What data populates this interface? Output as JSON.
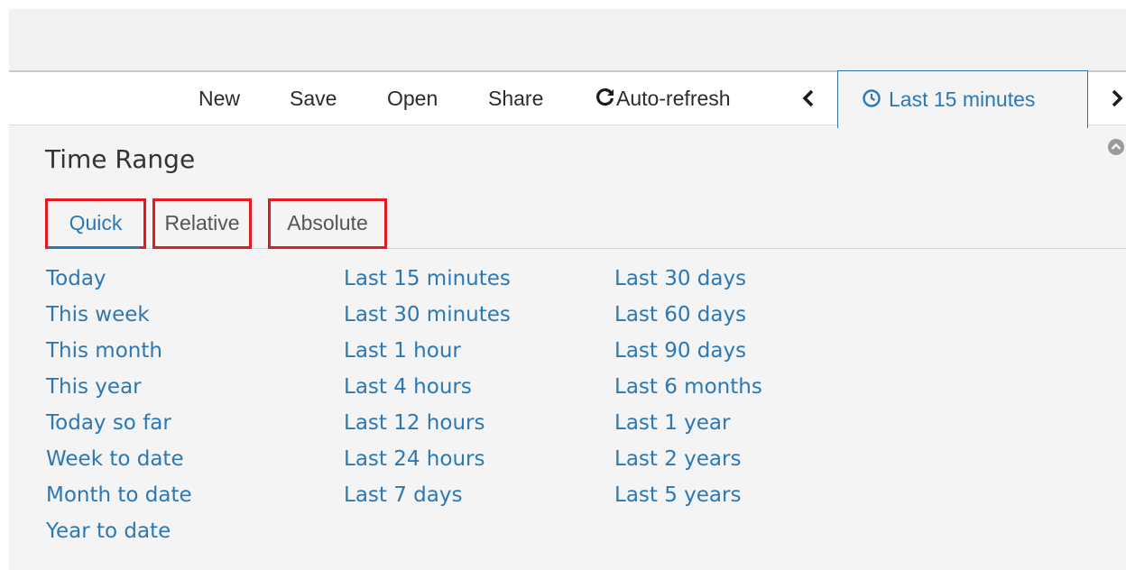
{
  "toolbar": {
    "items": [
      {
        "label": "New"
      },
      {
        "label": "Save"
      },
      {
        "label": "Open"
      },
      {
        "label": "Share"
      },
      {
        "label": "Auto-refresh",
        "icon": "refresh-icon"
      }
    ],
    "time_picker": {
      "label": "Last 15 minutes",
      "icon": "clock-icon"
    },
    "prev_icon": "chevron-left-icon",
    "next_icon": "chevron-right-icon"
  },
  "panel": {
    "title": "Time Range",
    "collapse_icon": "collapse-up-icon",
    "tabs": [
      {
        "label": "Quick",
        "active": true
      },
      {
        "label": "Relative",
        "active": false
      },
      {
        "label": "Absolute",
        "active": false
      }
    ],
    "highlight_color": "#e21b23",
    "link_color": "#2b78b5"
  },
  "quick_ranges": {
    "columns": [
      [
        "Today",
        "This week",
        "This month",
        "This year",
        "Today so far",
        "Week to date",
        "Month to date",
        "Year to date"
      ],
      [
        "Last 15 minutes",
        "Last 30 minutes",
        "Last 1 hour",
        "Last 4 hours",
        "Last 12 hours",
        "Last 24 hours",
        "Last 7 days"
      ],
      [
        "Last 30 days",
        "Last 60 days",
        "Last 90 days",
        "Last 6 months",
        "Last 1 year",
        "Last 2 years",
        "Last 5 years"
      ]
    ]
  }
}
